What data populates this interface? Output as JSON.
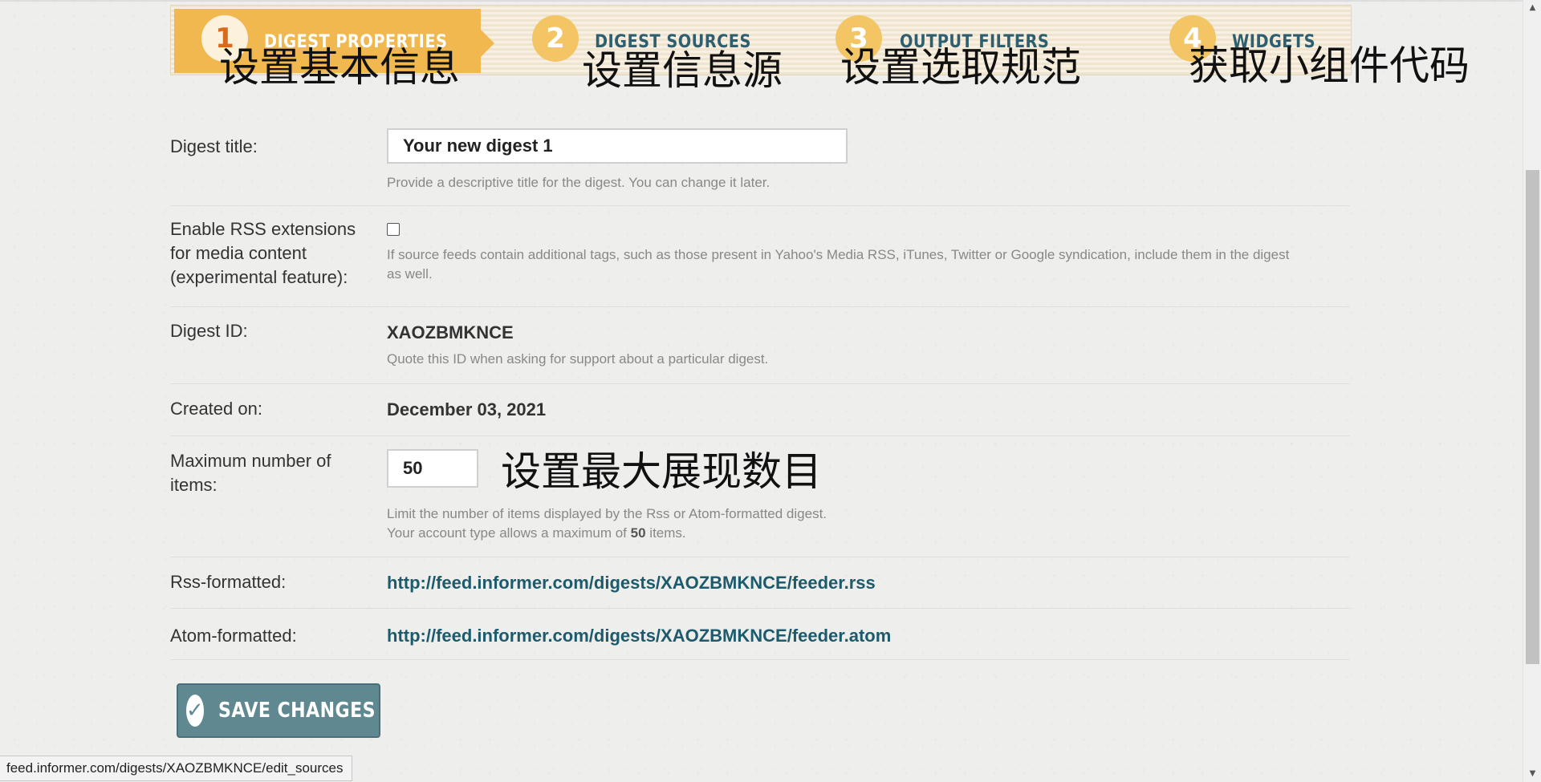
{
  "wizard": {
    "steps": [
      {
        "num": "1",
        "title": "DIGEST PROPERTIES",
        "note": "设置基本信息",
        "active": true
      },
      {
        "num": "2",
        "title": "DIGEST SOURCES",
        "note": "设置信息源",
        "active": false
      },
      {
        "num": "3",
        "title": "OUTPUT FILTERS",
        "note": "设置选取规范",
        "active": false
      },
      {
        "num": "4",
        "title": "WIDGETS",
        "note": "获取小组件代码",
        "active": false
      }
    ]
  },
  "form": {
    "digest_title": {
      "label": "Digest title:",
      "value": "Your new digest 1",
      "hint": "Provide a descriptive title for the digest. You can change it later."
    },
    "rss_extensions": {
      "label_lines": [
        "Enable RSS extensions",
        "for media content",
        "(experimental feature):"
      ],
      "checked": false,
      "hint_lines": [
        "If source feeds contain additional tags, such as those present in Yahoo's Media RSS, iTunes, Twitter or Google syndication, include them in the digest",
        "as well."
      ]
    },
    "digest_id": {
      "label": "Digest ID:",
      "value": "XAOZBMKNCE",
      "hint": "Quote this ID when asking for support about a particular digest."
    },
    "created_on": {
      "label": "Created on:",
      "value": "December 03, 2021"
    },
    "max_items": {
      "label_lines": [
        "Maximum number of",
        "items:"
      ],
      "value": "50",
      "note": "设置最大展现数目",
      "hint_line1": "Limit the number of items displayed by the Rss or Atom-formatted digest.",
      "hint_line2_prefix": "Your account type allows a maximum of ",
      "hint_line2_max": "50",
      "hint_line2_suffix": " items."
    },
    "rss_formatted": {
      "label": "Rss-formatted:",
      "url": "http://feed.informer.com/digests/XAOZBMKNCE/feeder.rss"
    },
    "atom_formatted": {
      "label": "Atom-formatted:",
      "url": "http://feed.informer.com/digests/XAOZBMKNCE/feeder.atom"
    },
    "save_label": "SAVE CHANGES",
    "save_icon": "check-icon"
  },
  "status_bar": {
    "text": "feed.informer.com/digests/XAOZBMKNCE/edit_sources"
  },
  "colors": {
    "accent_orange": "#f0b84f",
    "step_number_active": "#d86a1c",
    "step_title_inactive": "#2f5f6f",
    "link": "#1d5a6b",
    "button": "#5f8891"
  }
}
